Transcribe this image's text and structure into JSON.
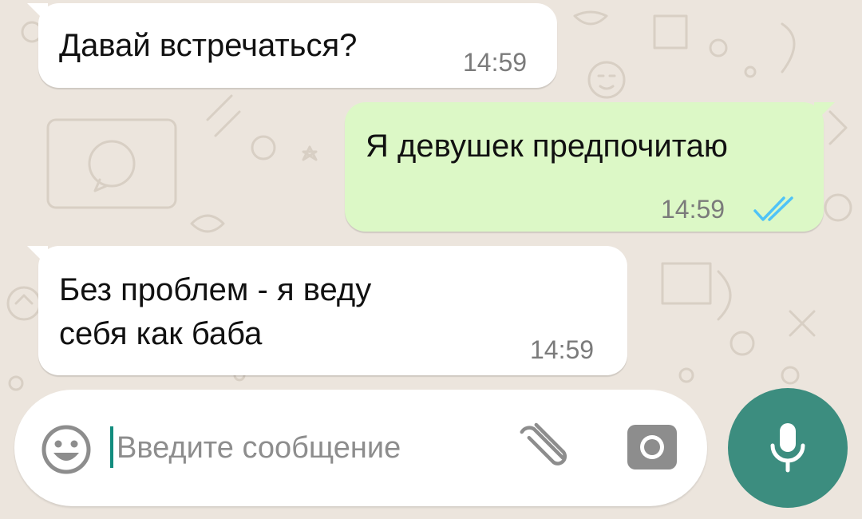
{
  "conversation": {
    "messages": [
      {
        "direction": "incoming",
        "text": "Давай встречаться?",
        "time": "14:59"
      },
      {
        "direction": "outgoing",
        "text": "Я девушек предпочитаю",
        "time": "14:59",
        "status": "read-double-check"
      },
      {
        "direction": "incoming",
        "lines": [
          "Без проблем - я веду",
          "себя как баба"
        ],
        "time": "14:59"
      }
    ]
  },
  "composer": {
    "placeholder": "Введите сообщение",
    "icons": {
      "emoji": "emoji-icon",
      "attach": "paperclip-icon",
      "camera": "camera-icon",
      "send": "microphone-icon"
    }
  },
  "colors": {
    "background": "#ece5dd",
    "incoming_bubble": "#ffffff",
    "outgoing_bubble": "#dcf8c6",
    "read_ticks": "#4fc3f7",
    "mic_button": "#3c8d7f",
    "caret": "#128c7e"
  }
}
